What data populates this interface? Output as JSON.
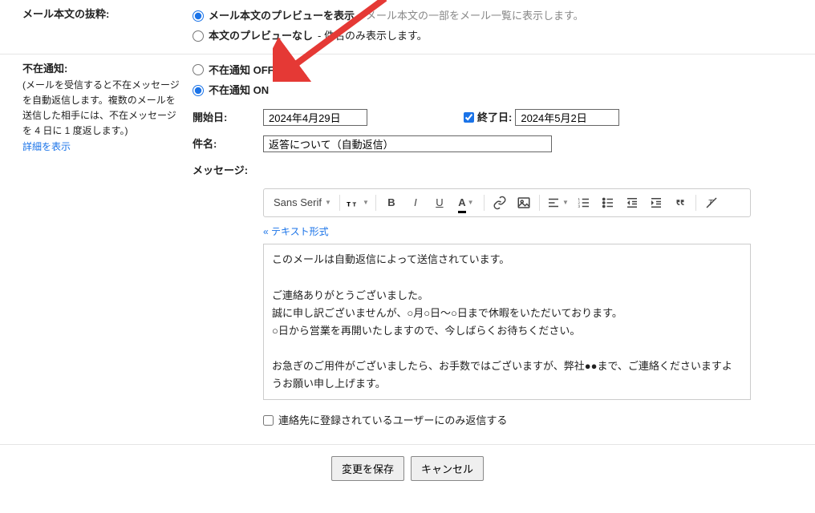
{
  "snippet_section": {
    "title": "メール本文の抜粋:",
    "opt1_bold": "メール本文のプレビューを表示",
    "opt1_rest": " - メール本文の一部をメール一覧に表示します。",
    "opt2_bold": "本文のプレビューなし",
    "opt2_rest": " - 件名のみ表示します。"
  },
  "vacation": {
    "title": "不在通知:",
    "desc": "(メールを受信すると不在メッセージを自動返信します。複数のメールを送信した相手には、不在メッセージを 4 日に 1 度返します。)",
    "learn_more": "詳細を表示",
    "off_label": "不在通知 OFF",
    "on_label": "不在通知 ON",
    "start_label": "開始日:",
    "start_value": "2024年4月29日",
    "end_checkbox_label": "終了日:",
    "end_value": "2024年5月2日",
    "subject_label": "件名:",
    "subject_value": "返答について（自動返信）",
    "message_label": "メッセージ:",
    "font_name": "Sans Serif",
    "plain_text_link": "« テキスト形式",
    "message_body": "このメールは自動返信によって送信されています。\n\nご連絡ありがとうございました。\n誠に申し訳ございませんが、○月○日〜○日まで休暇をいただいております。\n○日から営業を再開いたしますので、今しばらくお待ちください。\n\nお急ぎのご用件がございましたら、お手数ではございますが、弊社●●まで、ご連絡くださいますようお願い申し上げます。",
    "contacts_only": "連絡先に登録されているユーザーにのみ返信する"
  },
  "buttons": {
    "save": "変更を保存",
    "cancel": "キャンセル"
  }
}
